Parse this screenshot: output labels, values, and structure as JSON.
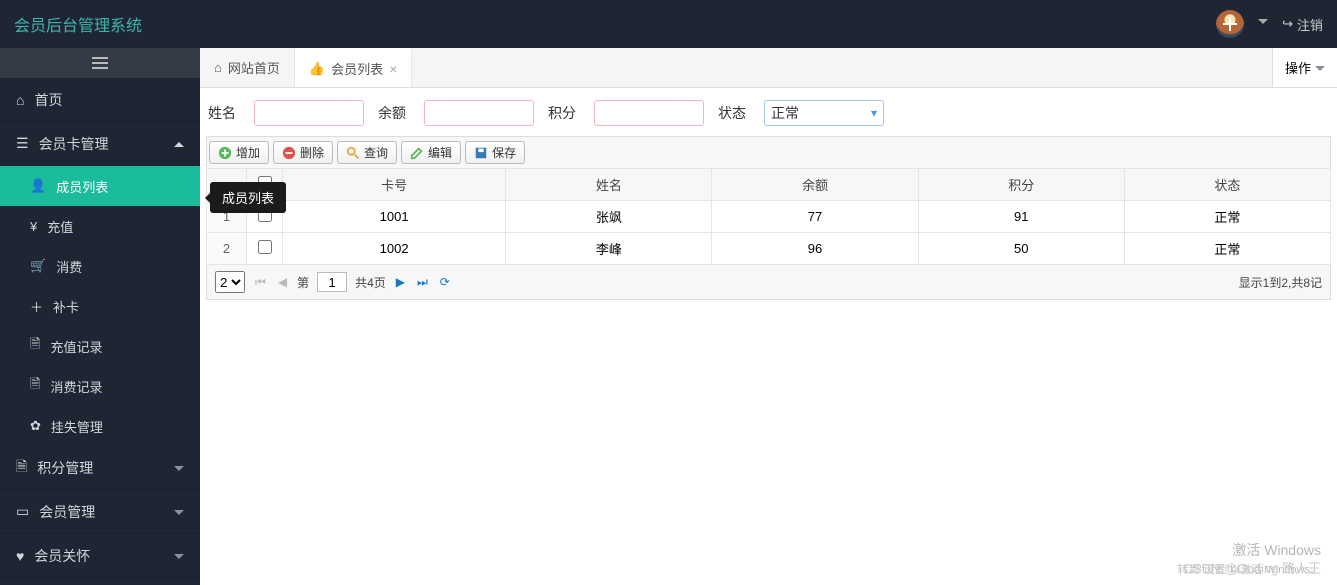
{
  "header": {
    "title": "会员后台管理系统",
    "logout": "注销"
  },
  "sidebar": {
    "items": [
      {
        "label": "首页"
      },
      {
        "label": "会员卡管理"
      },
      {
        "label": "积分管理"
      },
      {
        "label": "会员管理"
      },
      {
        "label": "会员关怀"
      }
    ],
    "card_sub": [
      {
        "label": "成员列表"
      },
      {
        "label": "充值"
      },
      {
        "label": "消费"
      },
      {
        "label": "补卡"
      },
      {
        "label": "充值记录"
      },
      {
        "label": "消费记录"
      },
      {
        "label": "挂失管理"
      }
    ]
  },
  "tooltip": "成员列表",
  "tabs": {
    "home": "网站首页",
    "member": "会员列表",
    "ops": "操作"
  },
  "filter": {
    "name_label": "姓名",
    "balance_label": "余额",
    "points_label": "积分",
    "status_label": "状态",
    "status_value": "正常"
  },
  "toolbar": {
    "add": "增加",
    "del": "删除",
    "query": "查询",
    "edit": "编辑",
    "save": "保存"
  },
  "grid": {
    "headers": {
      "card": "卡号",
      "name": "姓名",
      "balance": "余额",
      "points": "积分",
      "status": "状态"
    },
    "rows": [
      {
        "num": "1",
        "card": "1001",
        "name": "张飒",
        "balance": "77",
        "points": "91",
        "status": "正常"
      },
      {
        "num": "2",
        "card": "1002",
        "name": "李峰",
        "balance": "96",
        "points": "50",
        "status": "正常"
      }
    ]
  },
  "pager": {
    "size": "2",
    "page_prefix": "第",
    "page": "1",
    "total_text": "共4页",
    "info": "显示1到2,共8记"
  },
  "watermark": {
    "line1": "激活 Windows",
    "line2": "转到\"设置\"以激活 Windows。",
    "csdn": "CSDN @Coding 路人王"
  }
}
